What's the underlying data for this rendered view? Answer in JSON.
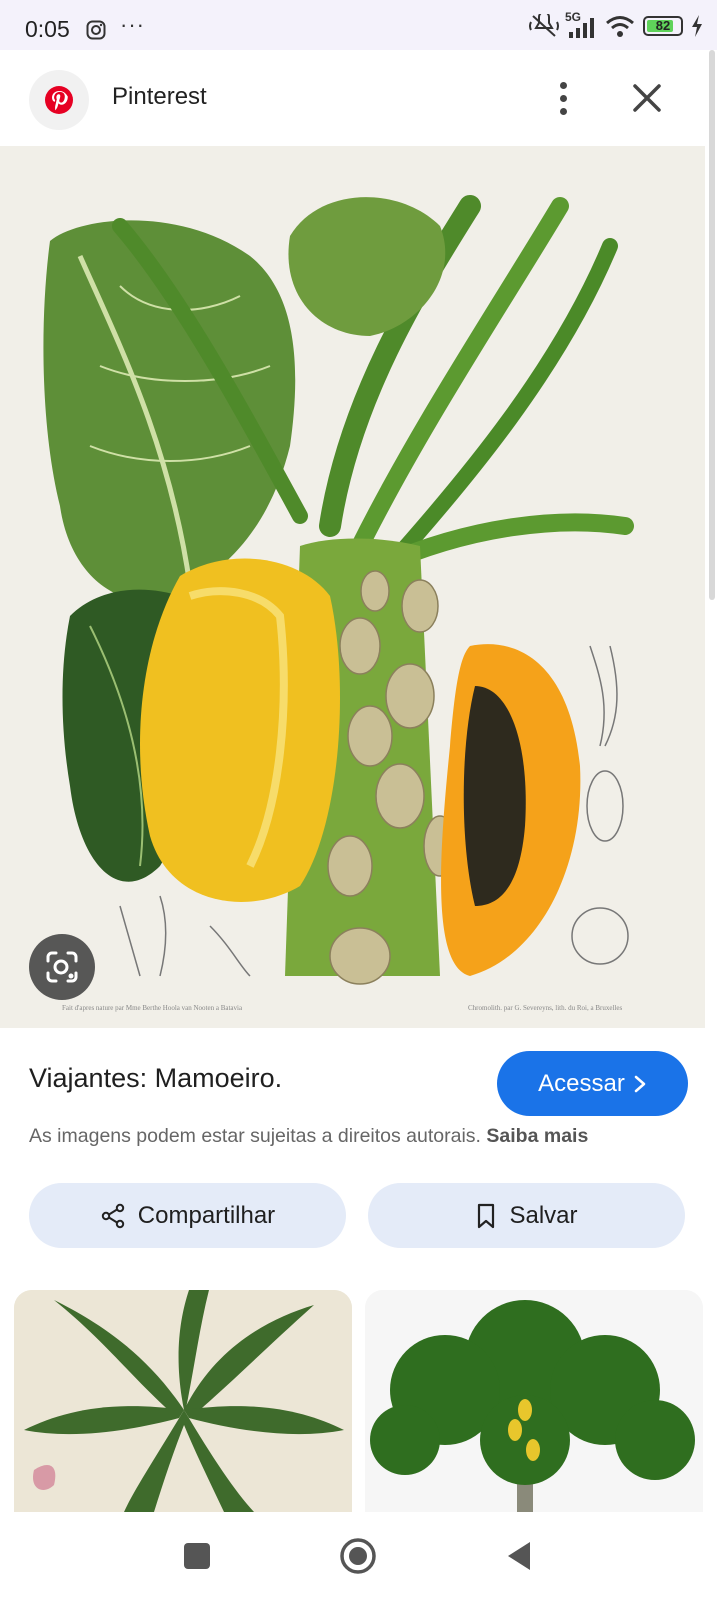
{
  "status_bar": {
    "time": "0:05",
    "overflow": "···",
    "network": "5G",
    "battery_level": "82",
    "battery_fraction": 0.82,
    "icons": [
      "instagram-icon",
      "mute-icon",
      "signal-icon",
      "wifi-icon",
      "battery-icon",
      "charging-icon"
    ]
  },
  "header": {
    "site_name": "Pinterest",
    "brand_color": "#e60023",
    "icons": [
      "pinterest-logo",
      "more-vert-icon",
      "close-icon"
    ]
  },
  "image": {
    "caption_left": "Fait d'apres nature par Mme Berthe Hoola van Nooten a Batavia",
    "caption_right": "Chromolith. par G. Severeyns, lith. du Roi, a Bruxelles"
  },
  "result": {
    "title": "Viajantes: Mamoeiro.",
    "visit_label": "Acessar",
    "copyright_text": "As imagens podem estar sujeitas a direitos autorais.",
    "learn_more": "Saiba mais",
    "accent_color": "#1a73e8"
  },
  "actions": {
    "share_label": "Compartilhar",
    "save_label": "Salvar"
  },
  "related": {
    "items": [
      "papaya-leaf-botanical-illustration",
      "papaya-tree-illustration"
    ]
  },
  "nav_bar": {
    "icons": [
      "recents-square-icon",
      "home-circle-icon",
      "back-triangle-icon"
    ]
  }
}
